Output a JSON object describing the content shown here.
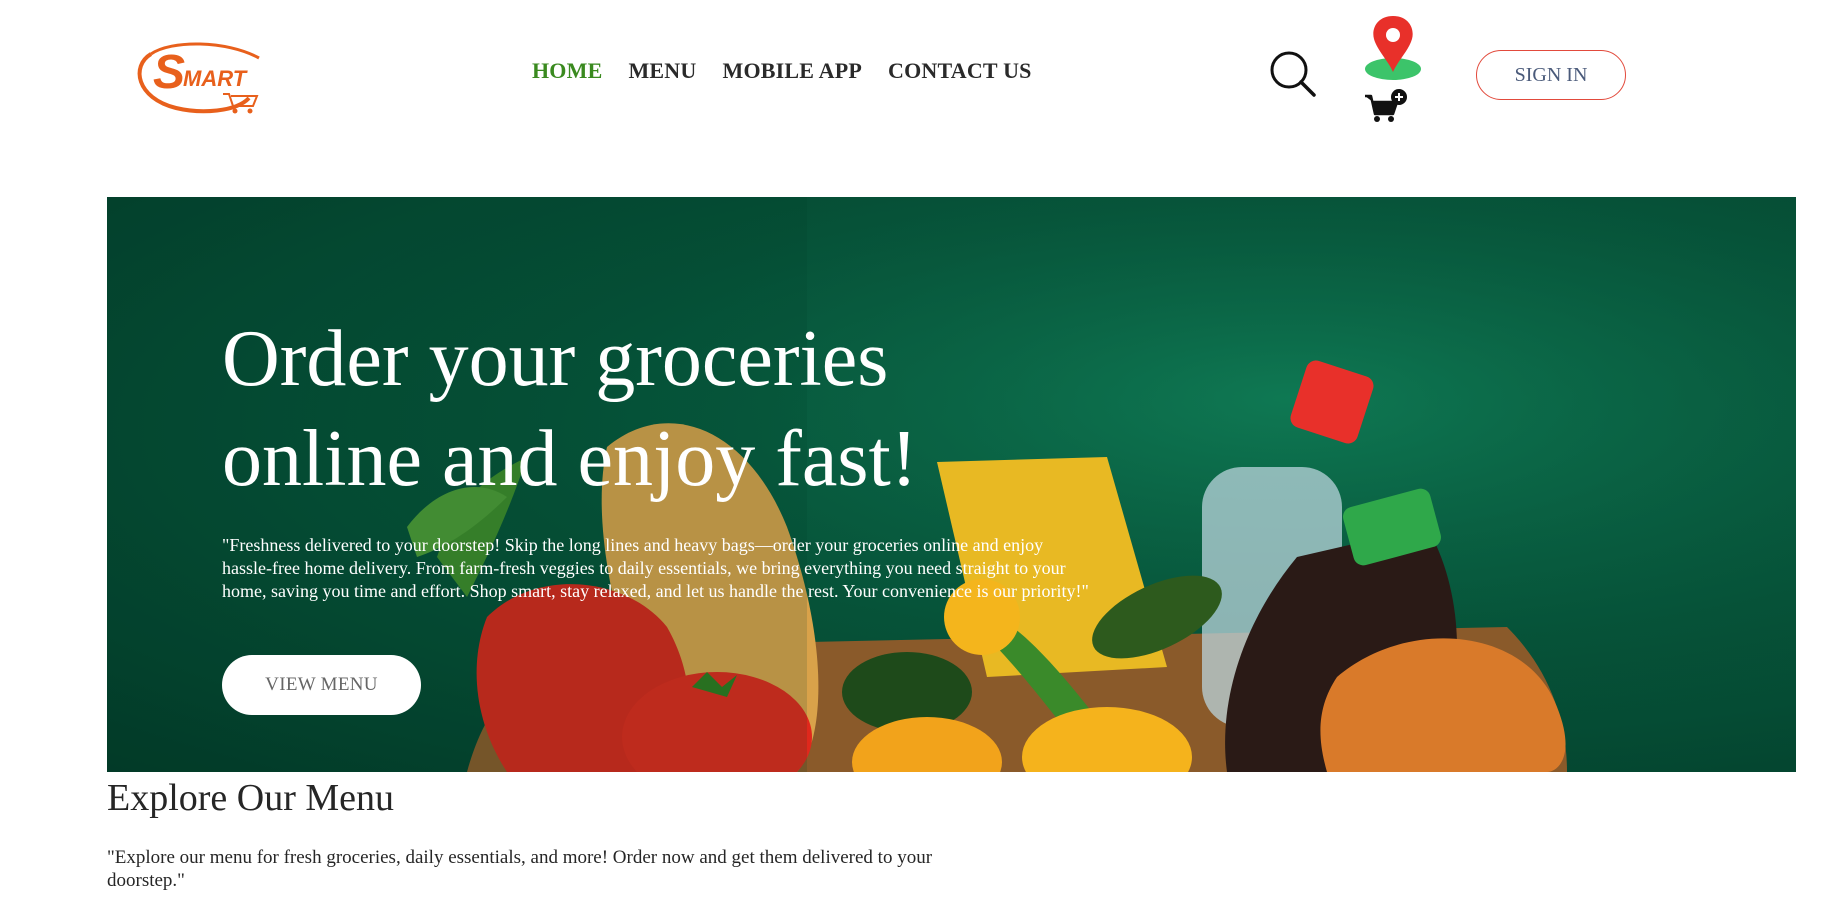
{
  "header": {
    "logo_text": "SMART",
    "nav": [
      {
        "label": "HOME",
        "active": true
      },
      {
        "label": "MENU",
        "active": false
      },
      {
        "label": "MOBILE APP",
        "active": false
      },
      {
        "label": "CONTACT US",
        "active": false
      }
    ],
    "signin_label": "SIGN IN",
    "icons": [
      "search-icon",
      "location-pin-icon",
      "cart-add-icon"
    ]
  },
  "hero": {
    "title_line1": "Order your groceries",
    "title_line2": "online and enjoy fast!",
    "description": "\"Freshness delivered to your doorstep! Skip the long lines and heavy bags—order your groceries online and enjoy hassle-free home delivery. From farm-fresh veggies to daily essentials, we bring everything you need straight to your home, saving you time and effort. Shop smart, stay relaxed, and let us handle the rest. Your convenience is our priority!\"",
    "cta_label": "VIEW MENU"
  },
  "explore": {
    "title": "Explore Our Menu",
    "description": "\"Explore our menu for fresh groceries, daily essentials, and more! Order now and get them delivered to your doorstep.\""
  },
  "colors": {
    "nav_active": "#3a8a1f",
    "brand_orange": "#e8601c",
    "signin_border": "#e24a3c",
    "hero_bg": "#06553a"
  }
}
